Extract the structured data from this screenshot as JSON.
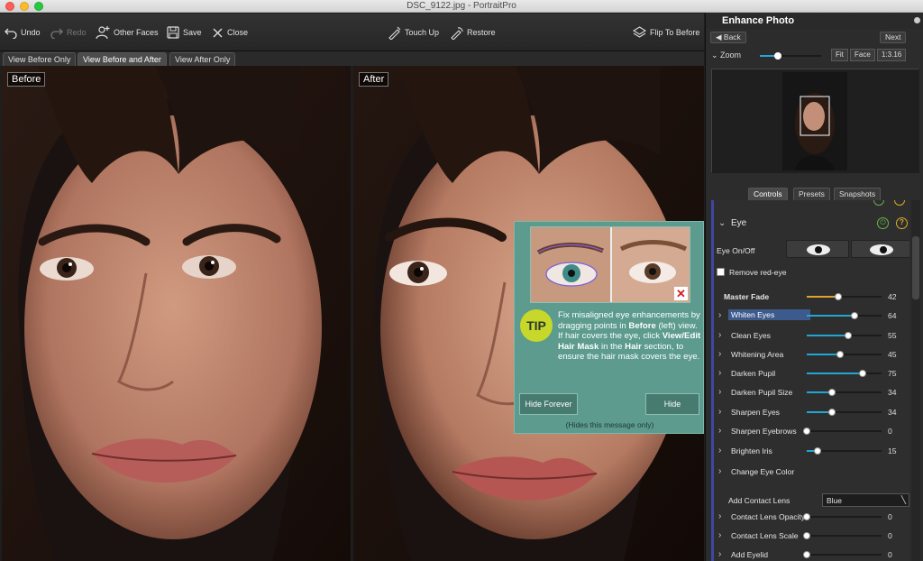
{
  "window": {
    "title": "DSC_9122.jpg - PortraitPro"
  },
  "toolbar": {
    "undo": "Undo",
    "redo": "Redo",
    "other_faces": "Other Faces",
    "save": "Save",
    "close": "Close",
    "touch_up": "Touch Up",
    "restore": "Restore",
    "flip_to_before": "Flip To Before"
  },
  "view_tabs": {
    "before_only": "View Before Only",
    "before_and_after": "View Before and After",
    "after_only": "View After Only"
  },
  "photos": {
    "before_label": "Before",
    "after_label": "After"
  },
  "tip": {
    "badge": "TIP",
    "line1": "Fix misaligned eye enhancements by dragging points in ",
    "before_word": "Before",
    "line2": " (left) view.",
    "line3": "If hair covers the eye, click ",
    "hair_mask": "View/Edit Hair Mask",
    "line4": " in the ",
    "hair_word": "Hair",
    "line5": " section, to ensure the hair mask covers the eye.",
    "hide_forever": "Hide Forever",
    "hide": "Hide",
    "note": "(Hides this message only)"
  },
  "panel": {
    "title": "Enhance Photo",
    "back": "Back",
    "next": "Next",
    "zoom_label": "Zoom",
    "fit": "Fit",
    "face": "Face",
    "zoom_ratio": "1:3.16",
    "zoom_level": 0.3
  },
  "control_tabs": {
    "controls": "Controls",
    "presets": "Presets",
    "snapshots": "Snapshots"
  },
  "controls": {
    "section": "Eye",
    "eye_onoff": "Eye On/Off",
    "remove_redeye": "Remove red-eye",
    "add_contact_lens": "Add Contact Lens",
    "contact_lens_value": "Blue",
    "sliders": [
      {
        "label": "Master Fade",
        "value": "42"
      },
      {
        "label": "Whiten Eyes",
        "value": "64"
      },
      {
        "label": "Clean Eyes",
        "value": "55"
      },
      {
        "label": "Whitening Area",
        "value": "45"
      },
      {
        "label": "Darken Pupil",
        "value": "75"
      },
      {
        "label": "Darken Pupil Size",
        "value": "34"
      },
      {
        "label": "Sharpen Eyes",
        "value": "34"
      },
      {
        "label": "Sharpen Eyebrows",
        "value": "0"
      },
      {
        "label": "Brighten Iris",
        "value": "15"
      },
      {
        "label": "Change Eye Color",
        "value": ""
      },
      {
        "label": "Contact Lens Opacity",
        "value": "0"
      },
      {
        "label": "Contact Lens Scale",
        "value": "0"
      },
      {
        "label": "Add Eyelid",
        "value": "0"
      }
    ]
  },
  "colors": {
    "accent": "#22a6d6",
    "tip_bg": "#5c9b8e",
    "tip_badge": "#c7d82b",
    "master_fade": "#e0a22a"
  }
}
